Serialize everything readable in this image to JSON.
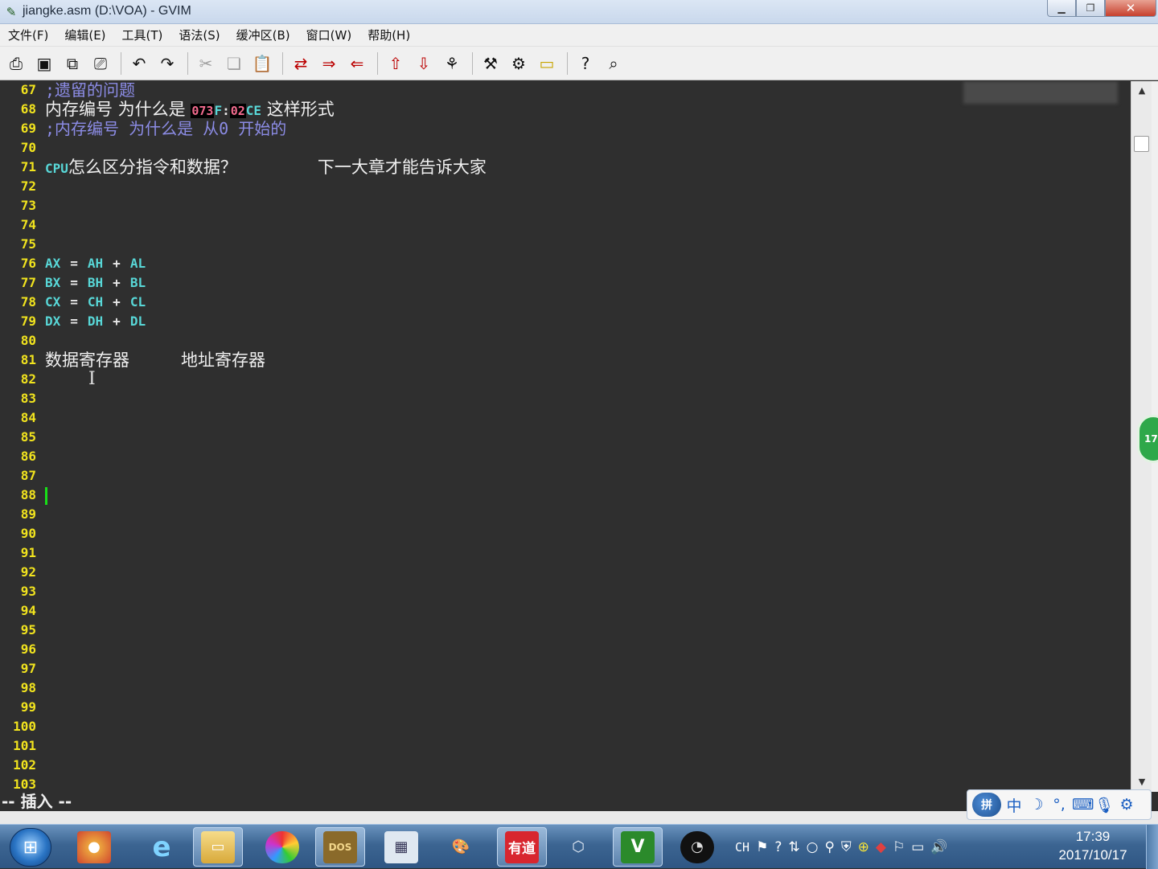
{
  "window": {
    "title": "jiangke.asm (D:\\VOA) - GVIM"
  },
  "menu": [
    "文件(F)",
    "编辑(E)",
    "工具(T)",
    "语法(S)",
    "缓冲区(B)",
    "窗口(W)",
    "帮助(H)"
  ],
  "toolbar_icons": [
    "open-icon",
    "save-icon",
    "save-all-icon",
    "print-icon",
    "undo-icon",
    "redo-icon",
    "cut-icon",
    "copy-icon",
    "paste-icon",
    "find-replace-icon",
    "find-next-icon",
    "find-prev-icon",
    "load-session-icon",
    "save-session-icon",
    "run-script-icon",
    "make-icon",
    "run-ctags-icon",
    "tag-jump-icon",
    "help-icon",
    "find-help-icon"
  ],
  "editor": {
    "lines": [
      {
        "n": "67",
        "text": ";遗留的问题"
      },
      {
        "n": "68",
        "pre": "内存编号 为什么是 ",
        "hl1": "073",
        "mid1": "F",
        ":": ":",
        "hl2": "02",
        "mid2": "CE",
        "post": " 这样形式"
      },
      {
        "n": "69",
        "text": ";内存编号 为什么是 从0 开始的"
      },
      {
        "n": "70"
      },
      {
        "n": "71",
        "kw": "CPU",
        "a": "怎么区分指令和数据？",
        "b": "下一大章才能告诉大家"
      },
      {
        "n": "72"
      },
      {
        "n": "73"
      },
      {
        "n": "74"
      },
      {
        "n": "75"
      },
      {
        "n": "76",
        "r1": "AX",
        "r2": "AH",
        "r3": "AL"
      },
      {
        "n": "77",
        "r1": "BX",
        "r2": "BH",
        "r3": "BL"
      },
      {
        "n": "78",
        "r1": "CX",
        "r2": "CH",
        "r3": "CL"
      },
      {
        "n": "79",
        "r1": "DX",
        "r2": "DH",
        "r3": "DL"
      },
      {
        "n": "80"
      },
      {
        "n": "81",
        "a": "数据寄存器",
        "b": "地址寄存器"
      },
      {
        "n": "82"
      },
      {
        "n": "83"
      },
      {
        "n": "84"
      },
      {
        "n": "85"
      },
      {
        "n": "86"
      },
      {
        "n": "87"
      },
      {
        "n": "88"
      },
      {
        "n": "89"
      },
      {
        "n": "90"
      },
      {
        "n": "91"
      },
      {
        "n": "92"
      },
      {
        "n": "93"
      },
      {
        "n": "94"
      },
      {
        "n": "95"
      },
      {
        "n": "96"
      },
      {
        "n": "97"
      },
      {
        "n": "98"
      },
      {
        "n": "99"
      },
      {
        "n": "100"
      },
      {
        "n": "101"
      },
      {
        "n": "102"
      },
      {
        "n": "103"
      }
    ],
    "operators": {
      "eq": "=",
      "plus": "+"
    }
  },
  "status": {
    "mode": "-- 插入 --"
  },
  "floating_badge": "17",
  "ime": {
    "logo": "拼",
    "mode": "中"
  },
  "taskbar": {
    "apps": [
      "explorer-icon",
      "ie-icon",
      "folder-icon",
      "picasa-icon",
      "dosbox-icon",
      "calculator-icon",
      "paint-icon",
      "youdao-icon",
      "virtualbox-icon",
      "gvim-icon",
      "obs-icon"
    ],
    "app_labels": {
      "dosbox": "DOS",
      "youdao": "有道"
    },
    "tray": {
      "lang": "CH"
    },
    "time": "17:39",
    "date": "2017/10/17"
  },
  "colors": {
    "line_number": "#f2e41e",
    "comment": "#8c8ce6",
    "keyword": "#58d7d7",
    "background": "#2f2f2f",
    "cursor": "#18e018"
  }
}
